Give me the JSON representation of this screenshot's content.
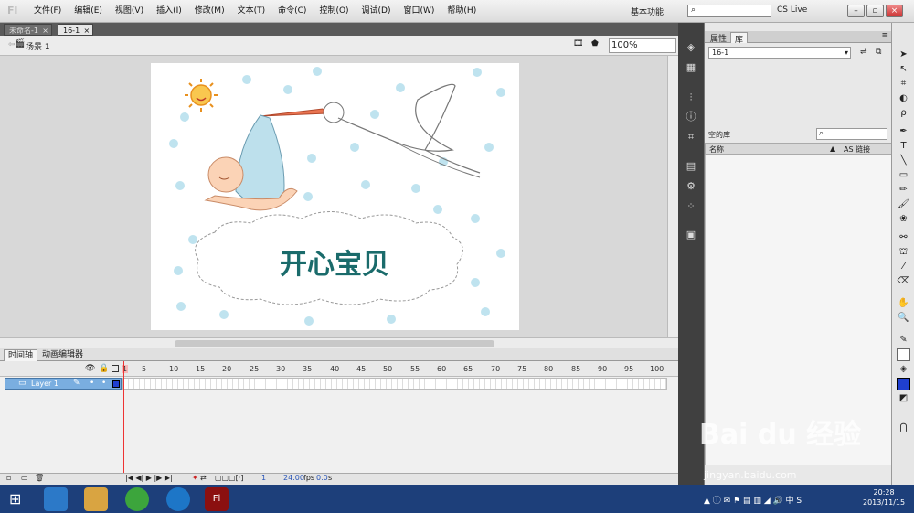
{
  "app": {
    "logo": "Fl"
  },
  "menu": [
    "文件(F)",
    "编辑(E)",
    "视图(V)",
    "插入(I)",
    "修改(M)",
    "文本(T)",
    "命令(C)",
    "控制(O)",
    "调试(D)",
    "窗口(W)",
    "帮助(H)"
  ],
  "header": {
    "workspace": "基本功能",
    "cslive": "CS Live"
  },
  "tabs": [
    {
      "label": "未命名-1"
    },
    {
      "label": "16-1"
    }
  ],
  "scene": {
    "name": "场景 1",
    "zoom": "100%"
  },
  "stage": {
    "title_text": "开心宝贝"
  },
  "timeline": {
    "tabs": [
      "时间轴",
      "动画编辑器"
    ],
    "layer": "Layer 1",
    "frame_numbers": [
      "1",
      "5",
      "10",
      "15",
      "20",
      "25",
      "30",
      "35",
      "40",
      "45",
      "50",
      "55",
      "60",
      "65",
      "70",
      "75",
      "80",
      "85",
      "90",
      "95",
      "100"
    ],
    "current_frame": "1",
    "fps": "24.00",
    "fps_unit": "fps",
    "time": "0.0",
    "time_unit": "s"
  },
  "panel": {
    "tabs": [
      "属性",
      "库"
    ],
    "library_select": "16-1",
    "empty_library": "空的库",
    "col_name": "名称",
    "col_linkage": "AS 链接"
  },
  "watermark": {
    "brand": "Bai du 经验",
    "url": "jingyan.baidu.com"
  },
  "clock": {
    "time": "20:28",
    "date": "2013/11/15"
  },
  "colors": {
    "menubar": "#e8e8e8",
    "stage": "#ffffff",
    "accent": "#7aaee0",
    "taskbar": "#1d3f7a",
    "title_text": "#1a6b6b"
  }
}
